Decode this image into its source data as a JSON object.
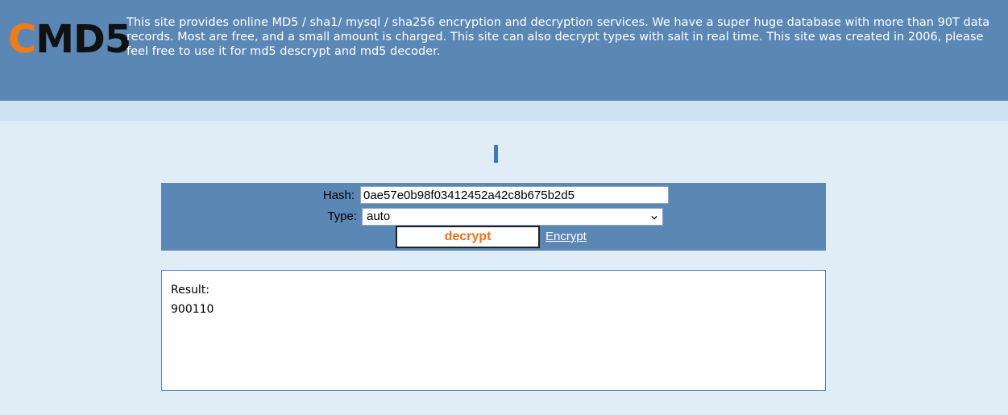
{
  "header": {
    "logo": {
      "c_letter": "C",
      "rest": "MD5"
    },
    "intro": "This site provides online MD5 / sha1/ mysql / sha256 encryption and decryption services. We have a super huge database with more than 90T data records. Most are free, and a small amount is charged. This site can also decrypt types with salt in real time. This site was created in 2006, please feel free to use it for md5 descrypt and md5 decoder."
  },
  "form": {
    "hash_label": "Hash:",
    "hash_value": "0ae57e0b98f03412452a42c8b675b2d5",
    "type_label": "Type:",
    "type_value": "auto",
    "decrypt_label": "decrypt",
    "encrypt_label": "Encrypt"
  },
  "result": {
    "label": "Result:",
    "value": "900110"
  },
  "colors": {
    "header_bg": "#5b87b5",
    "page_bg": "#e1edf6",
    "subbar_bg": "#cde2f2",
    "accent_orange": "#f07019",
    "cursor_blue": "#3f76c6"
  },
  "icons": {
    "select_arrow": "chevron-down-icon"
  }
}
